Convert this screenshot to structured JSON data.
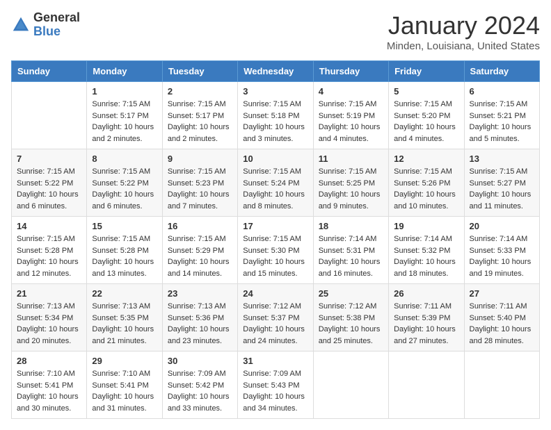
{
  "header": {
    "logo_general": "General",
    "logo_blue": "Blue",
    "month": "January 2024",
    "location": "Minden, Louisiana, United States"
  },
  "days_of_week": [
    "Sunday",
    "Monday",
    "Tuesday",
    "Wednesday",
    "Thursday",
    "Friday",
    "Saturday"
  ],
  "weeks": [
    [
      {
        "day": "",
        "info": ""
      },
      {
        "day": "1",
        "info": "Sunrise: 7:15 AM\nSunset: 5:17 PM\nDaylight: 10 hours\nand 2 minutes."
      },
      {
        "day": "2",
        "info": "Sunrise: 7:15 AM\nSunset: 5:17 PM\nDaylight: 10 hours\nand 2 minutes."
      },
      {
        "day": "3",
        "info": "Sunrise: 7:15 AM\nSunset: 5:18 PM\nDaylight: 10 hours\nand 3 minutes."
      },
      {
        "day": "4",
        "info": "Sunrise: 7:15 AM\nSunset: 5:19 PM\nDaylight: 10 hours\nand 4 minutes."
      },
      {
        "day": "5",
        "info": "Sunrise: 7:15 AM\nSunset: 5:20 PM\nDaylight: 10 hours\nand 4 minutes."
      },
      {
        "day": "6",
        "info": "Sunrise: 7:15 AM\nSunset: 5:21 PM\nDaylight: 10 hours\nand 5 minutes."
      }
    ],
    [
      {
        "day": "7",
        "info": "Sunrise: 7:15 AM\nSunset: 5:22 PM\nDaylight: 10 hours\nand 6 minutes."
      },
      {
        "day": "8",
        "info": "Sunrise: 7:15 AM\nSunset: 5:22 PM\nDaylight: 10 hours\nand 6 minutes."
      },
      {
        "day": "9",
        "info": "Sunrise: 7:15 AM\nSunset: 5:23 PM\nDaylight: 10 hours\nand 7 minutes."
      },
      {
        "day": "10",
        "info": "Sunrise: 7:15 AM\nSunset: 5:24 PM\nDaylight: 10 hours\nand 8 minutes."
      },
      {
        "day": "11",
        "info": "Sunrise: 7:15 AM\nSunset: 5:25 PM\nDaylight: 10 hours\nand 9 minutes."
      },
      {
        "day": "12",
        "info": "Sunrise: 7:15 AM\nSunset: 5:26 PM\nDaylight: 10 hours\nand 10 minutes."
      },
      {
        "day": "13",
        "info": "Sunrise: 7:15 AM\nSunset: 5:27 PM\nDaylight: 10 hours\nand 11 minutes."
      }
    ],
    [
      {
        "day": "14",
        "info": "Sunrise: 7:15 AM\nSunset: 5:28 PM\nDaylight: 10 hours\nand 12 minutes."
      },
      {
        "day": "15",
        "info": "Sunrise: 7:15 AM\nSunset: 5:28 PM\nDaylight: 10 hours\nand 13 minutes."
      },
      {
        "day": "16",
        "info": "Sunrise: 7:15 AM\nSunset: 5:29 PM\nDaylight: 10 hours\nand 14 minutes."
      },
      {
        "day": "17",
        "info": "Sunrise: 7:15 AM\nSunset: 5:30 PM\nDaylight: 10 hours\nand 15 minutes."
      },
      {
        "day": "18",
        "info": "Sunrise: 7:14 AM\nSunset: 5:31 PM\nDaylight: 10 hours\nand 16 minutes."
      },
      {
        "day": "19",
        "info": "Sunrise: 7:14 AM\nSunset: 5:32 PM\nDaylight: 10 hours\nand 18 minutes."
      },
      {
        "day": "20",
        "info": "Sunrise: 7:14 AM\nSunset: 5:33 PM\nDaylight: 10 hours\nand 19 minutes."
      }
    ],
    [
      {
        "day": "21",
        "info": "Sunrise: 7:13 AM\nSunset: 5:34 PM\nDaylight: 10 hours\nand 20 minutes."
      },
      {
        "day": "22",
        "info": "Sunrise: 7:13 AM\nSunset: 5:35 PM\nDaylight: 10 hours\nand 21 minutes."
      },
      {
        "day": "23",
        "info": "Sunrise: 7:13 AM\nSunset: 5:36 PM\nDaylight: 10 hours\nand 23 minutes."
      },
      {
        "day": "24",
        "info": "Sunrise: 7:12 AM\nSunset: 5:37 PM\nDaylight: 10 hours\nand 24 minutes."
      },
      {
        "day": "25",
        "info": "Sunrise: 7:12 AM\nSunset: 5:38 PM\nDaylight: 10 hours\nand 25 minutes."
      },
      {
        "day": "26",
        "info": "Sunrise: 7:11 AM\nSunset: 5:39 PM\nDaylight: 10 hours\nand 27 minutes."
      },
      {
        "day": "27",
        "info": "Sunrise: 7:11 AM\nSunset: 5:40 PM\nDaylight: 10 hours\nand 28 minutes."
      }
    ],
    [
      {
        "day": "28",
        "info": "Sunrise: 7:10 AM\nSunset: 5:41 PM\nDaylight: 10 hours\nand 30 minutes."
      },
      {
        "day": "29",
        "info": "Sunrise: 7:10 AM\nSunset: 5:41 PM\nDaylight: 10 hours\nand 31 minutes."
      },
      {
        "day": "30",
        "info": "Sunrise: 7:09 AM\nSunset: 5:42 PM\nDaylight: 10 hours\nand 33 minutes."
      },
      {
        "day": "31",
        "info": "Sunrise: 7:09 AM\nSunset: 5:43 PM\nDaylight: 10 hours\nand 34 minutes."
      },
      {
        "day": "",
        "info": ""
      },
      {
        "day": "",
        "info": ""
      },
      {
        "day": "",
        "info": ""
      }
    ]
  ]
}
